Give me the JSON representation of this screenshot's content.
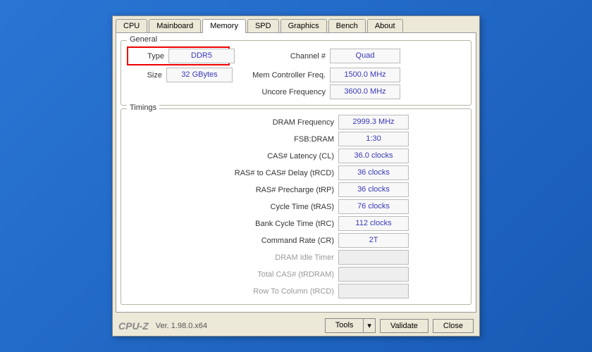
{
  "tabs": [
    "CPU",
    "Mainboard",
    "Memory",
    "SPD",
    "Graphics",
    "Bench",
    "About"
  ],
  "activeTab": "Memory",
  "general": {
    "title": "General",
    "type": {
      "label": "Type",
      "value": "DDR5"
    },
    "size": {
      "label": "Size",
      "value": "32 GBytes"
    },
    "channel": {
      "label": "Channel #",
      "value": "Quad"
    },
    "memctrl": {
      "label": "Mem Controller Freq.",
      "value": "1500.0 MHz"
    },
    "uncore": {
      "label": "Uncore Frequency",
      "value": "3600.0 MHz"
    }
  },
  "timings": {
    "title": "Timings",
    "rows": [
      {
        "label": "DRAM Frequency",
        "value": "2999.3 MHz"
      },
      {
        "label": "FSB:DRAM",
        "value": "1:30"
      },
      {
        "label": "CAS# Latency (CL)",
        "value": "36.0 clocks"
      },
      {
        "label": "RAS# to CAS# Delay (tRCD)",
        "value": "36 clocks"
      },
      {
        "label": "RAS# Precharge (tRP)",
        "value": "36 clocks"
      },
      {
        "label": "Cycle Time (tRAS)",
        "value": "76 clocks"
      },
      {
        "label": "Bank Cycle Time (tRC)",
        "value": "112 clocks"
      },
      {
        "label": "Command Rate (CR)",
        "value": "2T"
      },
      {
        "label": "DRAM Idle Timer",
        "value": ""
      },
      {
        "label": "Total CAS# (tRDRAM)",
        "value": ""
      },
      {
        "label": "Row To Column (tRCD)",
        "value": ""
      }
    ]
  },
  "footer": {
    "logo": "CPU-Z",
    "version": "Ver. 1.98.0.x64",
    "tools": "Tools",
    "validate": "Validate",
    "close": "Close"
  }
}
